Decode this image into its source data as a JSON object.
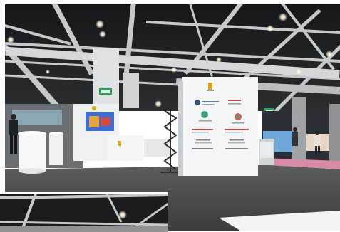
{
  "scene": {
    "colors": {
      "ceiling": "#1b1f22",
      "truss": "#c9cdd1",
      "floor": "#3f4346",
      "carpet": "#55595c",
      "panel": "#f2f4f6",
      "pink_floor": "#d98aa8",
      "exit_sign": "#2e9a58",
      "screen": "#3b6fd8",
      "light": "#fffbe6"
    },
    "booth_sign_logos": [
      "dragon-logo",
      "green-circle-logo",
      "colorful-circle-logo"
    ],
    "icons": [
      "exit-sign-icon",
      "ceiling-light-icon"
    ]
  }
}
